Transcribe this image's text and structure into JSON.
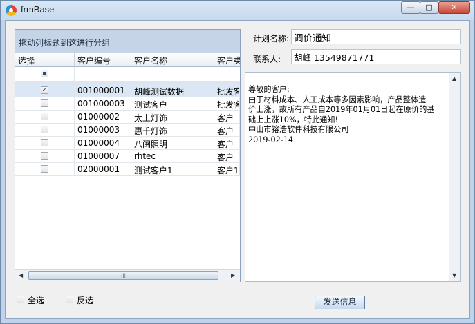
{
  "window": {
    "title": "frmBase",
    "min_glyph": "—",
    "max_glyph": "□",
    "close_glyph": "✕"
  },
  "grid": {
    "group_panel_text": "拖动列标题到这进行分组",
    "columns": [
      "选择",
      "客户编号",
      "客户名称",
      "客户类"
    ],
    "rows": [
      {
        "checked": true,
        "code": "001000001",
        "name": "胡峰测试数据",
        "type": "批发客"
      },
      {
        "checked": false,
        "code": "001000003",
        "name": "测试客户",
        "type": "批发客"
      },
      {
        "checked": false,
        "code": "01000002",
        "name": "太上灯饰",
        "type": "客户"
      },
      {
        "checked": false,
        "code": "01000003",
        "name": "惠千灯饰",
        "type": "客户"
      },
      {
        "checked": false,
        "code": "01000004",
        "name": "八闽照明",
        "type": "客户"
      },
      {
        "checked": false,
        "code": "01000007",
        "name": "rhtec",
        "type": "客户"
      },
      {
        "checked": false,
        "code": "02000001",
        "name": "测试客户1",
        "type": "客户1"
      }
    ],
    "scroll_thumb_glyph": "|||"
  },
  "plan": {
    "label": "计划名称:",
    "value": "调价通知"
  },
  "contact": {
    "label": "联系人:",
    "value": "胡峰 13549871771"
  },
  "message": {
    "lines": [
      "尊敬的客户:",
      "由于材料成本、人工成本等多因素影响，产品整体造",
      "价上涨，故所有产品自2019年01月01日起在原价的基",
      "础上上涨10%，特此通知!",
      "中山市镕浩软件科技有限公司",
      "2019-02-14"
    ]
  },
  "footer": {
    "select_all": "全选",
    "invert": "反选",
    "send_button": "发送信息"
  },
  "colors": {
    "title_bar": "#c6d9ee",
    "group_panel": "#c5d4e6",
    "selected_row": "#dce7f5"
  }
}
